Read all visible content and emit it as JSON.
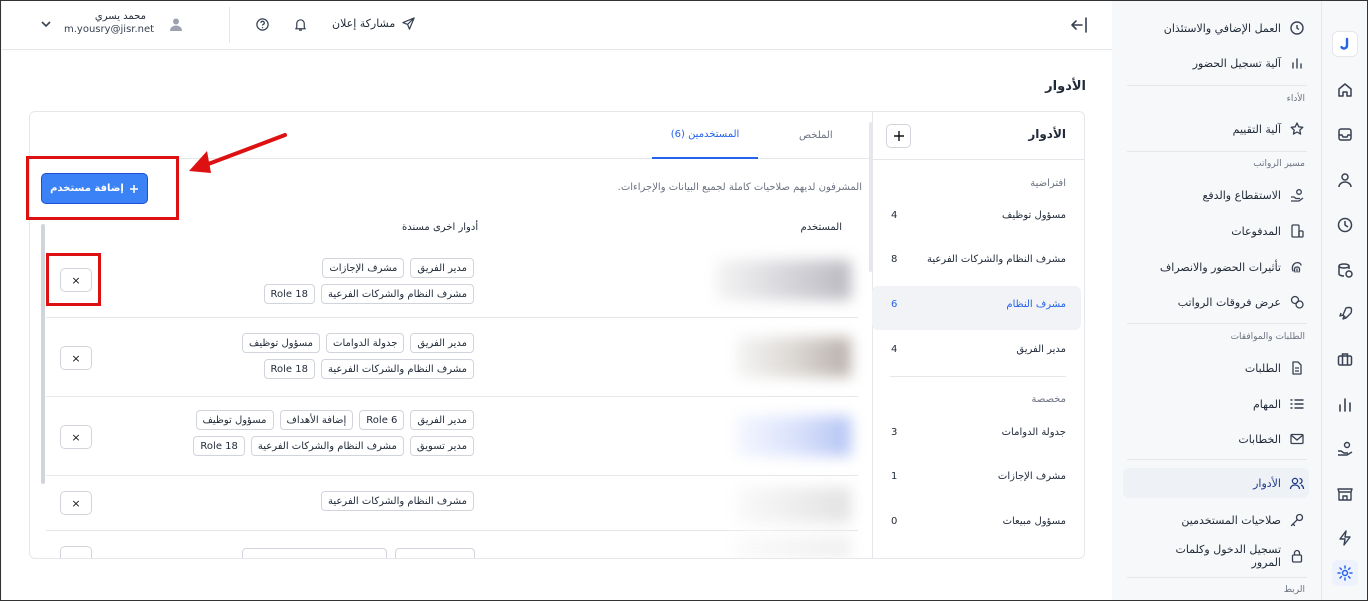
{
  "header": {
    "user_name": "محمد يسري",
    "user_email": "m.yousry@jisr.net",
    "share_label": "مشاركة إعلان"
  },
  "page_title": "الأدوار",
  "roles_panel": {
    "title": "الأدوار",
    "default_group": "افتراضية",
    "default_roles": [
      {
        "name": "مسؤول توظيف",
        "count": "4"
      },
      {
        "name": "مشرف النظام والشركات الفرعية",
        "count": "8"
      },
      {
        "name": "مشرف النظام",
        "count": "6"
      },
      {
        "name": "مدير الفريق",
        "count": "4"
      }
    ],
    "custom_group": "مخصصة",
    "custom_roles": [
      {
        "name": "جدولة الدوامات",
        "count": "3"
      },
      {
        "name": "مشرف الإجازات",
        "count": "1"
      },
      {
        "name": "مسؤول مبيعات",
        "count": "0"
      }
    ]
  },
  "tabs": {
    "summary": "الملخص",
    "users": "المستخدمين (6)"
  },
  "description": "المشرفون لديهم صلاحيات كاملة لجميع البيانات والإجراءات.",
  "add_user_label": "إضافة مستخدم",
  "table": {
    "col_user": "المستخدم",
    "col_other_roles": "أدوار اخرى مسندة",
    "rows": [
      {
        "chips": [
          "مدير الفريق",
          "مشرف الإجازات",
          "مشرف النظام والشركات الفرعية",
          "Role 18"
        ]
      },
      {
        "chips": [
          "مدير الفريق",
          "جدولة الدوامات",
          "مسؤول توظيف",
          "مشرف النظام والشركات الفرعية",
          "Role 18"
        ]
      },
      {
        "chips": [
          "مدير الفريق",
          "Role 6",
          "إضافة الأهداف",
          "مسؤول توظيف",
          "مدير تسويق",
          "مشرف النظام والشركات الفرعية",
          "Role 18"
        ]
      },
      {
        "chips": [
          "مشرف النظام والشركات الفرعية"
        ]
      }
    ],
    "remove_glyph": "×"
  },
  "sidebar": {
    "items_top": [
      {
        "label": "العمل الإضافي والاستئذان",
        "icon": "clock-plus-icon"
      },
      {
        "label": "آلية تسجيل الحضور",
        "icon": "bar-chart-icon"
      }
    ],
    "group_performance": "الأداء",
    "item_evaluation": "آلية التقييم",
    "group_payroll": "مسير الرواتب",
    "payroll_items": [
      {
        "label": "الاستقطاع والدفع",
        "icon": "hand-coins-icon"
      },
      {
        "label": "المدفوعات",
        "icon": "ledger-icon"
      },
      {
        "label": "تأثيرات الحضور والانصراف",
        "icon": "fingerprint-icon"
      },
      {
        "label": "عرض فروقات الرواتب",
        "icon": "coins-icon"
      }
    ],
    "group_requests": "الطلبات والموافقات",
    "request_items": [
      {
        "label": "الطلبات",
        "icon": "document-icon"
      },
      {
        "label": "المهام",
        "icon": "list-icon"
      },
      {
        "label": "الخطابات",
        "icon": "mail-icon"
      }
    ],
    "item_roles": "الأدوار",
    "item_permissions": "صلاحيات المستخدمين",
    "item_login": "تسجيل الدخول وكلمات المرور",
    "group_integration": "الربط"
  },
  "colors": {
    "accent": "#2563eb",
    "active_tab": "#2563eb",
    "annotation_red": "#dd1111"
  }
}
